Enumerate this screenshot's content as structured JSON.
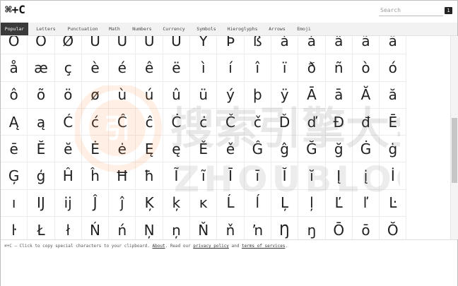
{
  "header": {
    "logo": "⌘+C",
    "search_placeholder": "Search",
    "shortcut_key": "1"
  },
  "tabs": [
    {
      "label": "Popular",
      "active": true
    },
    {
      "label": "Letters"
    },
    {
      "label": "Punctuation"
    },
    {
      "label": "Math"
    },
    {
      "label": "Numbers"
    },
    {
      "label": "Currency"
    },
    {
      "label": "Symbols"
    },
    {
      "label": "Hieroglyphs"
    },
    {
      "label": "Arrows"
    },
    {
      "label": "Emoji"
    }
  ],
  "characters": [
    "Õ",
    "Ö",
    "Ø",
    "Ù",
    "Ú",
    "Û",
    "Ü",
    "Ý",
    "Þ",
    "ß",
    "à",
    "á",
    "â",
    "ã",
    "ä",
    "å",
    "æ",
    "ç",
    "è",
    "é",
    "ê",
    "ë",
    "ì",
    "í",
    "î",
    "ï",
    "ð",
    "ñ",
    "ò",
    "ó",
    "ô",
    "õ",
    "ö",
    "ø",
    "ù",
    "ú",
    "û",
    "ü",
    "ý",
    "þ",
    "ÿ",
    "Ā",
    "ā",
    "Ă",
    "ă",
    "Ą",
    "ą",
    "Ć",
    "ć",
    "Ĉ",
    "ĉ",
    "Ċ",
    "ċ",
    "Č",
    "č",
    "Ď",
    "ď",
    "Đ",
    "đ",
    "Ē",
    "ē",
    "Ĕ",
    "ĕ",
    "Ė",
    "ė",
    "Ę",
    "ę",
    "Ě",
    "ě",
    "Ĝ",
    "ĝ",
    "Ğ",
    "ğ",
    "Ġ",
    "ġ",
    "Ģ",
    "ģ",
    "Ĥ",
    "ĥ",
    "Ħ",
    "ħ",
    "Ĩ",
    "ĩ",
    "Ī",
    "ī",
    "Ĭ",
    "ĭ",
    "Į",
    "į",
    "İ",
    "ı",
    "Ĳ",
    "ĳ",
    "Ĵ",
    "ĵ",
    "Ķ",
    "ķ",
    "ĸ",
    "Ĺ",
    "ĺ",
    "Ļ",
    "ļ",
    "Ľ",
    "ľ",
    "Ŀ",
    "ŀ",
    "Ł",
    "ł",
    "Ń",
    "ń",
    "Ņ",
    "ņ",
    "Ň",
    "ň",
    "ŉ",
    "Ŋ",
    "ŋ",
    "Ō",
    "ō",
    "Ŏ"
  ],
  "footer": {
    "prefix": "⌘+C — Click to copy special characters to your clipboard.",
    "about": "About",
    "mid": ". Read our",
    "privacy": "privacy policy",
    "and": "and",
    "terms": "terms of services",
    "end": "."
  },
  "watermark": {
    "main_text": "搜索引擎大全",
    "sub_text": "ZHOUBLOG.CN",
    "logo_glyph": "引",
    "color": "#ff8a3d"
  }
}
